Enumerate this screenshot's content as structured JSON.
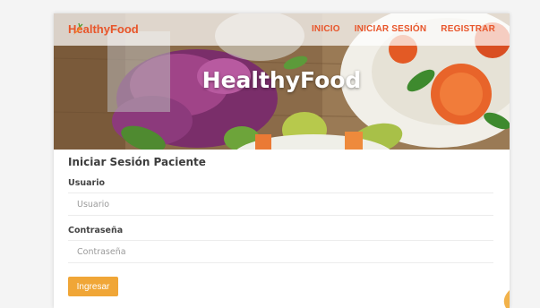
{
  "nav": {
    "brand": "HealthyFood",
    "links": [
      "INICIO",
      "INICIAR SESIÓN",
      "REGISTRAR"
    ]
  },
  "hero": {
    "title": "HealthyFood"
  },
  "form": {
    "title": "Iniciar Sesión Paciente",
    "username": {
      "label": "Usuario",
      "placeholder": "Usuario"
    },
    "password": {
      "label": "Contraseña",
      "placeholder": "Contraseña"
    },
    "submit_label": "Ingresar"
  },
  "colors": {
    "accent": "#e8552a",
    "button": "#f0a637"
  },
  "icons": {
    "brand": "carrot-icon"
  }
}
